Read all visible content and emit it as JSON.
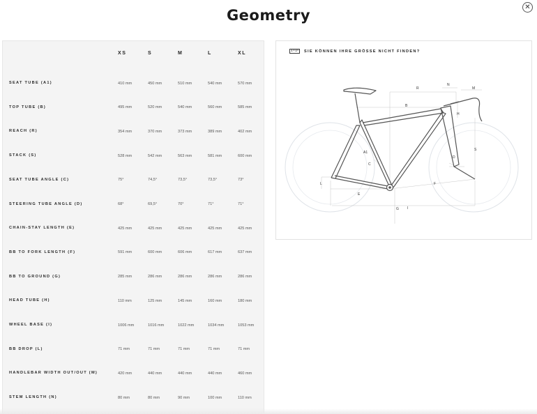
{
  "page": {
    "title": "Geometry",
    "close_icon": "close-icon"
  },
  "table": {
    "sizes": [
      "XS",
      "S",
      "M",
      "L",
      "XL"
    ],
    "rows": [
      {
        "label": "SEAT TUBE (A1)",
        "values": [
          "410 mm",
          "450 mm",
          "510 mm",
          "540 mm",
          "570 mm"
        ]
      },
      {
        "label": "TOP TUBE (B)",
        "values": [
          "495 mm",
          "520 mm",
          "540 mm",
          "560 mm",
          "585 mm"
        ]
      },
      {
        "label": "REACH (R)",
        "values": [
          "354 mm",
          "370 mm",
          "373 mm",
          "389 mm",
          "402 mm"
        ]
      },
      {
        "label": "STACK (S)",
        "values": [
          "528 mm",
          "542 mm",
          "563 mm",
          "581 mm",
          "600 mm"
        ]
      },
      {
        "label": "SEAT TUBE ANGLE (C)",
        "values": [
          "75°",
          "74,5°",
          "73,5°",
          "73,5°",
          "73°"
        ]
      },
      {
        "label": "STEERING TUBE ANGLE (D)",
        "values": [
          "68°",
          "69,5°",
          "70°",
          "71°",
          "71°"
        ]
      },
      {
        "label": "CHAIN-STAY LENGTH (E)",
        "values": [
          "425 mm",
          "425 mm",
          "425 mm",
          "425 mm",
          "425 mm"
        ]
      },
      {
        "label": "BB TO FORK LENGTH (F)",
        "values": [
          "591 mm",
          "600 mm",
          "606 mm",
          "617 mm",
          "637 mm"
        ]
      },
      {
        "label": "BB TO GROUND (G)",
        "values": [
          "285 mm",
          "286 mm",
          "286 mm",
          "286 mm",
          "286 mm"
        ]
      },
      {
        "label": "HEAD TUBE (H)",
        "values": [
          "110 mm",
          "125 mm",
          "145 mm",
          "160 mm",
          "180 mm"
        ]
      },
      {
        "label": "WHEEL BASE (I)",
        "values": [
          "1006 mm",
          "1016 mm",
          "1022 mm",
          "1034 mm",
          "1053 mm"
        ]
      },
      {
        "label": "BB DROP (L)",
        "values": [
          "71 mm",
          "71 mm",
          "71 mm",
          "71 mm",
          "71 mm"
        ]
      },
      {
        "label": "HANDLEBAR WIDTH OUT/OUT (M)",
        "values": [
          "420 mm",
          "440 mm",
          "440 mm",
          "440 mm",
          "460 mm"
        ]
      },
      {
        "label": "STEM LENGTH (N)",
        "values": [
          "80 mm",
          "80 mm",
          "90 mm",
          "100 mm",
          "110 mm"
        ]
      }
    ]
  },
  "diagram": {
    "help_text": "SIE KÖNNEN IHRE GRÖSSE NICHT FINDEN?",
    "help_icon": "ruler-icon",
    "labels": {
      "R": "R",
      "N": "N",
      "M": "M",
      "B": "B",
      "H": "H",
      "S": "S",
      "A1": "A1",
      "C": "C",
      "D": "D",
      "L": "L",
      "E": "E",
      "F": "F",
      "G": "G",
      "I": "I"
    }
  }
}
